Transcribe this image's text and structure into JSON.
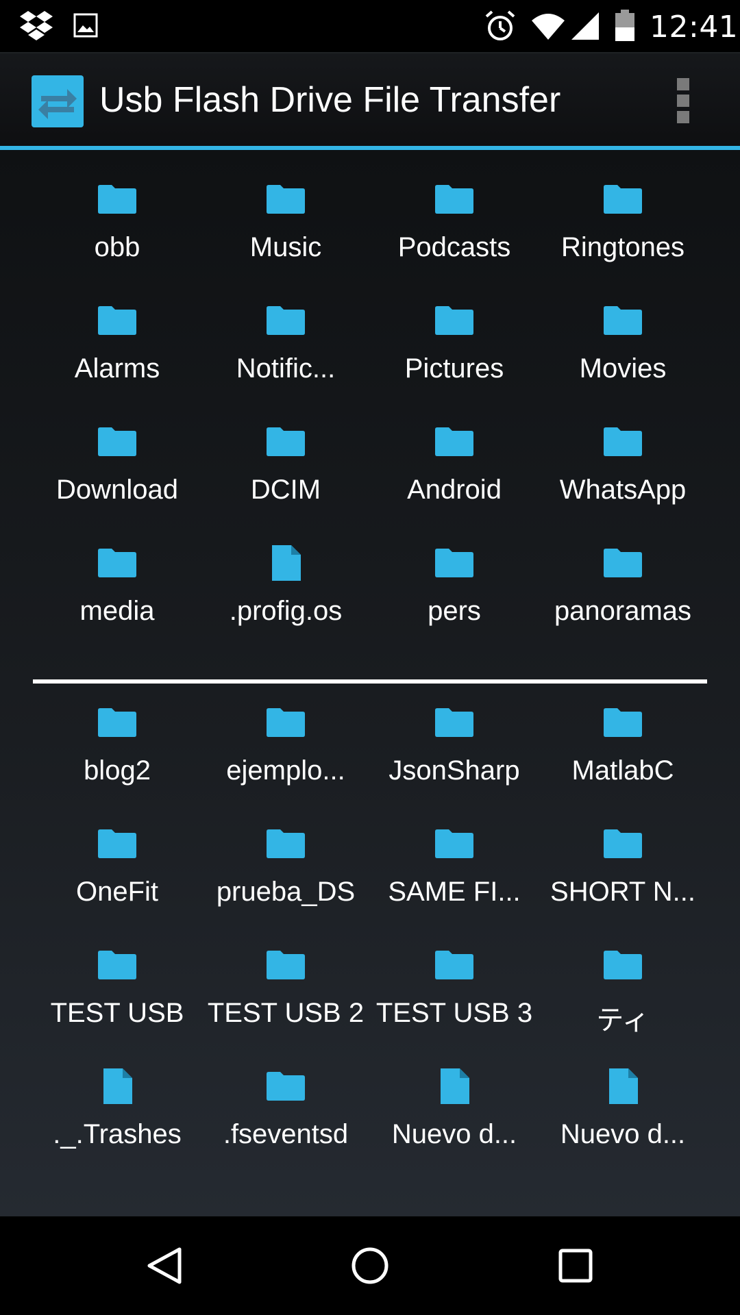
{
  "status_bar": {
    "time": "12:41",
    "icons": [
      "dropbox-icon",
      "gallery-icon",
      "alarm-icon",
      "wifi-icon",
      "signal-icon",
      "battery-icon"
    ]
  },
  "action_bar": {
    "title": "Usb Flash Drive File Transfer",
    "logo_icon": "transfer-arrows-icon",
    "menu_icon": "overflow-menu-icon"
  },
  "colors": {
    "accent": "#33b5e5",
    "background": "#000000",
    "folder": "#33b5e5"
  },
  "sections": [
    {
      "items": [
        {
          "name": "obb",
          "type": "folder"
        },
        {
          "name": "Music",
          "type": "folder"
        },
        {
          "name": "Podcasts",
          "type": "folder"
        },
        {
          "name": "Ringtones",
          "type": "folder"
        },
        {
          "name": "Alarms",
          "type": "folder"
        },
        {
          "name": "Notific...",
          "type": "folder"
        },
        {
          "name": "Pictures",
          "type": "folder"
        },
        {
          "name": "Movies",
          "type": "folder"
        },
        {
          "name": "Download",
          "type": "folder"
        },
        {
          "name": "DCIM",
          "type": "folder"
        },
        {
          "name": "Android",
          "type": "folder"
        },
        {
          "name": "WhatsApp",
          "type": "folder"
        },
        {
          "name": "media",
          "type": "folder"
        },
        {
          "name": ".profig.os",
          "type": "file"
        },
        {
          "name": "pers",
          "type": "folder"
        },
        {
          "name": "panoramas",
          "type": "folder"
        }
      ]
    },
    {
      "items": [
        {
          "name": "blog2",
          "type": "folder"
        },
        {
          "name": "ejemplo...",
          "type": "folder"
        },
        {
          "name": "JsonSharp",
          "type": "folder"
        },
        {
          "name": "MatlabC",
          "type": "folder"
        },
        {
          "name": "OneFit",
          "type": "folder"
        },
        {
          "name": "prueba_DS",
          "type": "folder"
        },
        {
          "name": "SAME FI...",
          "type": "folder"
        },
        {
          "name": "SHORT N...",
          "type": "folder"
        },
        {
          "name": "TEST USB",
          "type": "folder"
        },
        {
          "name": "TEST USB 2",
          "type": "folder"
        },
        {
          "name": "TEST USB 3",
          "type": "folder"
        },
        {
          "name": "ティ",
          "type": "folder"
        },
        {
          "name": "._.Trashes",
          "type": "file"
        },
        {
          "name": ".fseventsd",
          "type": "folder"
        },
        {
          "name": "Nuevo d...",
          "type": "file"
        },
        {
          "name": "Nuevo d...",
          "type": "file"
        }
      ]
    }
  ],
  "nav_bar": {
    "buttons": [
      "back-icon",
      "home-icon",
      "recents-icon"
    ]
  }
}
